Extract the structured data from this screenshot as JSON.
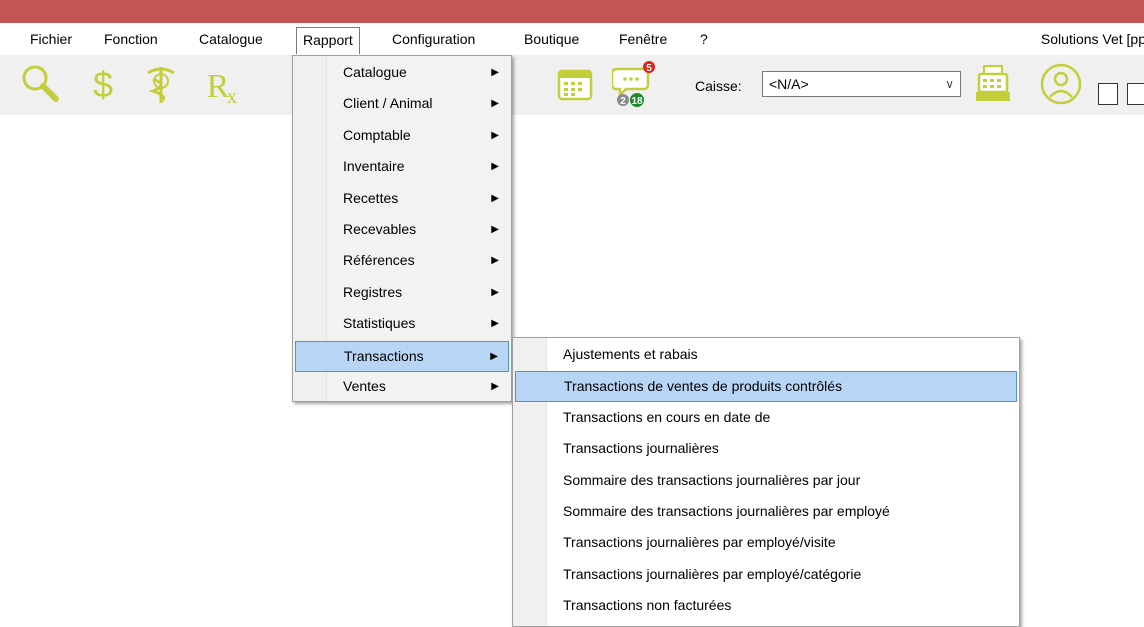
{
  "menubar": {
    "items": [
      "Fichier",
      "Fonction",
      "Catalogue",
      "Rapport",
      "Configuration",
      "Boutique",
      "Fenêtre",
      "?"
    ],
    "app_title": "Solutions Vet [pp"
  },
  "toolbar": {
    "icons": [
      "search-icon",
      "dollar-icon",
      "caduceus-icon",
      "rx-icon",
      "calendar-icon",
      "messages-icon",
      "cash-register-icon",
      "user-refresh-icon"
    ],
    "badges": {
      "red": "5",
      "gray": "2",
      "green": "18"
    },
    "caisse_label": "Caisse:",
    "caisse_value": "<N/A>"
  },
  "rapport_menu": {
    "items": [
      {
        "label": "Catalogue",
        "has_sub": true
      },
      {
        "label": "Client / Animal",
        "has_sub": true
      },
      {
        "label": "Comptable",
        "has_sub": true
      },
      {
        "label": "Inventaire",
        "has_sub": true
      },
      {
        "label": "Recettes",
        "has_sub": true
      },
      {
        "label": "Recevables",
        "has_sub": true
      },
      {
        "label": "Références",
        "has_sub": true
      },
      {
        "label": "Registres",
        "has_sub": true
      },
      {
        "label": "Statistiques",
        "has_sub": true
      },
      {
        "label": "Transactions",
        "has_sub": true,
        "highlighted": true
      },
      {
        "label": "Ventes",
        "has_sub": true
      }
    ]
  },
  "transactions_submenu": {
    "items": [
      {
        "label": "Ajustements et rabais"
      },
      {
        "label": "Transactions de ventes de produits contrôlés",
        "highlighted": true
      },
      {
        "label": "Transactions en cours en date de"
      },
      {
        "label": "Transactions journalières"
      },
      {
        "label": "Sommaire des transactions journalières par jour"
      },
      {
        "label": "Sommaire des transactions journalières par employé"
      },
      {
        "label": "Transactions journalières par employé/visite"
      },
      {
        "label": "Transactions journalières par employé/catégorie"
      },
      {
        "label": "Transactions non facturées"
      }
    ]
  },
  "colors": {
    "titlebar": "#c25555",
    "icon_accent": "#c2cf3a",
    "highlight": "#b8d5f5",
    "highlight_border": "#4d93d9"
  }
}
